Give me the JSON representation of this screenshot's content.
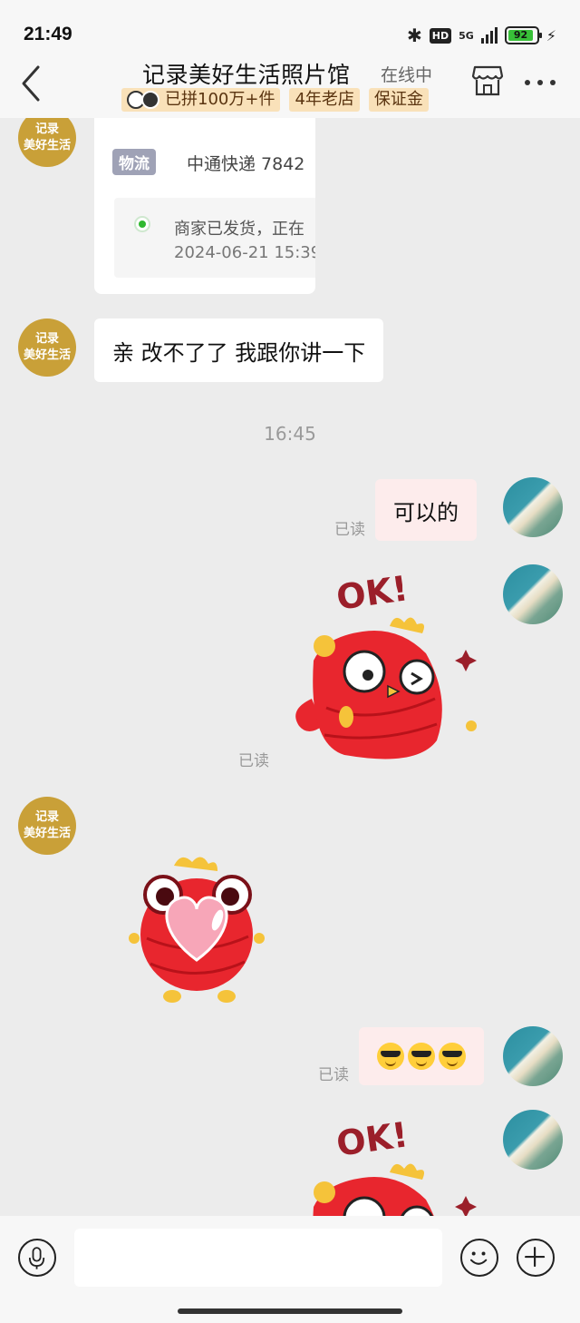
{
  "status_bar": {
    "time": "21:49",
    "network": "5G",
    "hd": "HD",
    "battery_level": "92"
  },
  "header": {
    "shop_name": "记录美好生活照片馆",
    "online_status": "在线中",
    "tags": [
      "已拼100万+件",
      "4年老店",
      "保证金"
    ]
  },
  "shop_avatar": {
    "line1": "记录",
    "line2": "美好生活"
  },
  "logistics": {
    "badge": "物流",
    "carrier": "中通快递  7842",
    "status": "商家已发货，正在",
    "time": "2024-06-21 15:39"
  },
  "messages": {
    "shop_text": "亲 改不了了  我跟你讲一下",
    "time_divider": "16:45",
    "user_text": "可以的",
    "read_label": "已读",
    "ok_sticker_text": "OK!"
  },
  "input": {
    "placeholder": ""
  },
  "colors": {
    "background": "#ececec",
    "accent_gold": "#c9a038",
    "outgoing_bubble": "#fdecec",
    "sticker_red": "#e8262e"
  }
}
